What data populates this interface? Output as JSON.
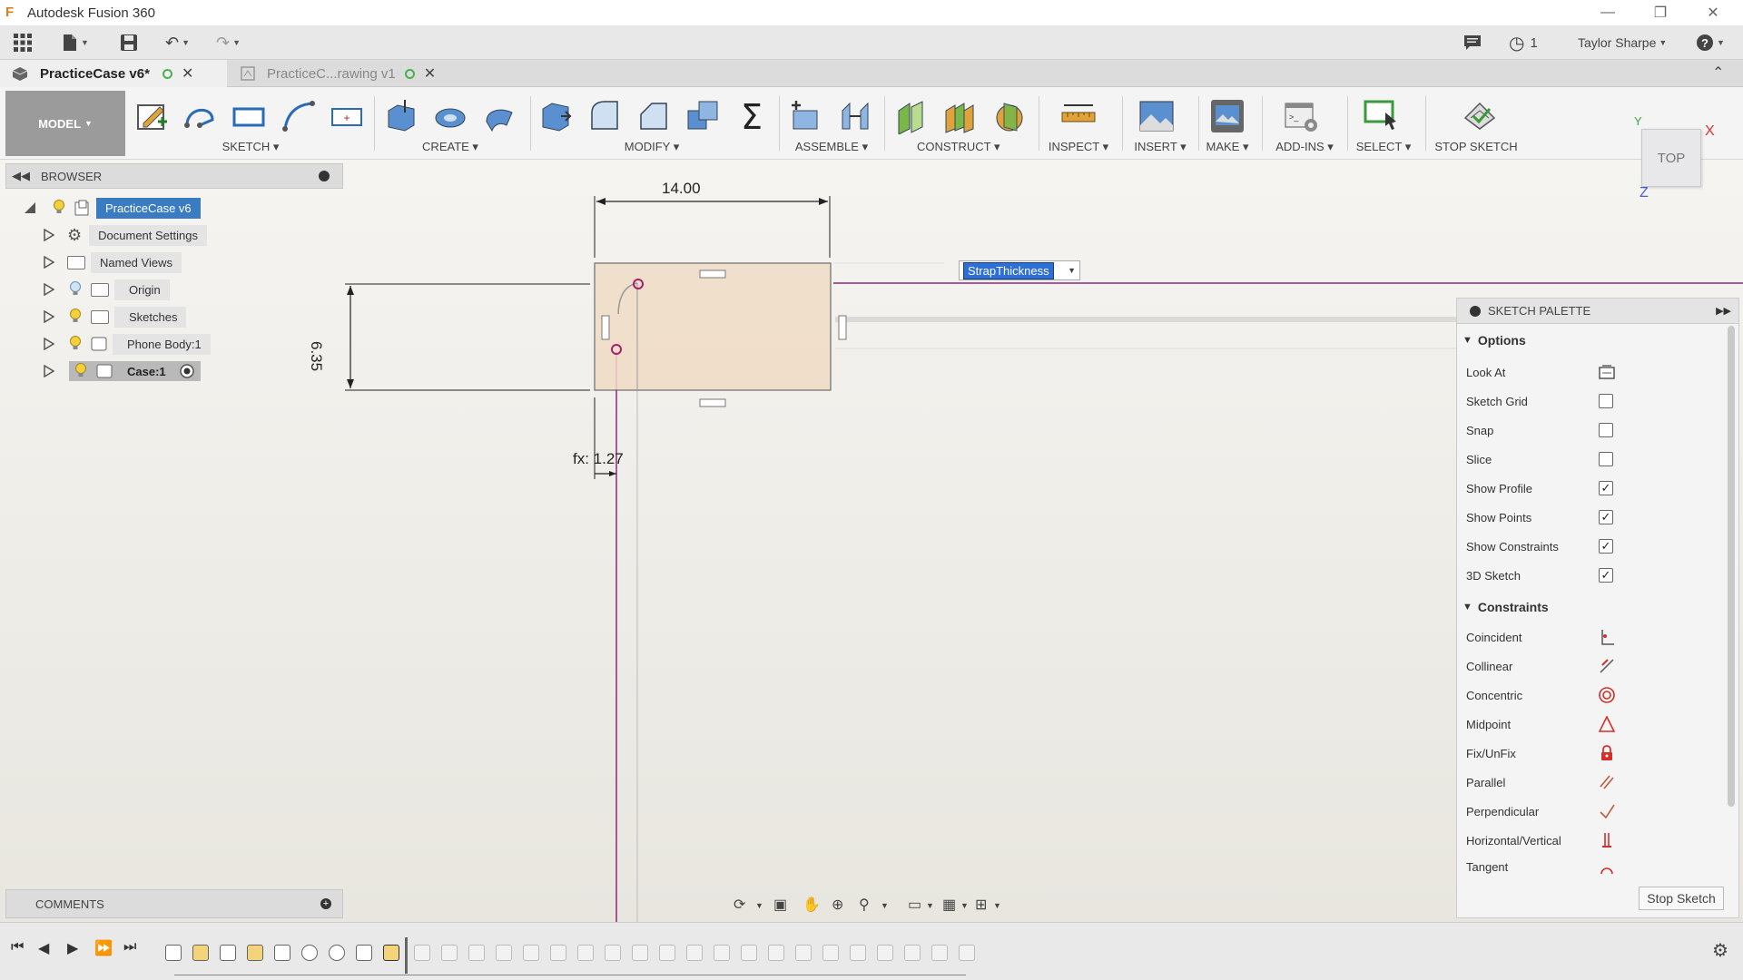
{
  "app": {
    "title": "Autodesk Fusion 360"
  },
  "quick_access": {
    "user_name": "Taylor Sharpe",
    "jobs_count": "1"
  },
  "tabs": [
    {
      "label": "PracticeCase v6*"
    },
    {
      "label": "PracticeC...rawing v1"
    }
  ],
  "toolbar": {
    "workspace": "MODEL",
    "groups": [
      {
        "label": "SKETCH"
      },
      {
        "label": "CREATE"
      },
      {
        "label": "MODIFY"
      },
      {
        "label": "ASSEMBLE"
      },
      {
        "label": "CONSTRUCT"
      },
      {
        "label": "INSPECT"
      },
      {
        "label": "INSERT"
      },
      {
        "label": "MAKE"
      },
      {
        "label": "ADD-INS"
      },
      {
        "label": "SELECT"
      },
      {
        "label": "STOP SKETCH"
      }
    ]
  },
  "browser": {
    "title": "BROWSER",
    "items": [
      {
        "label": "PracticeCase v6"
      },
      {
        "label": "Document Settings"
      },
      {
        "label": "Named Views"
      },
      {
        "label": "Origin"
      },
      {
        "label": "Sketches"
      },
      {
        "label": "Phone Body:1"
      },
      {
        "label": "Case:1"
      }
    ]
  },
  "sketch": {
    "width_dimension": "14.00",
    "height_dimension": "6.35",
    "offset_dimension": "fx: 1.27",
    "parameter_input": "StrapThickness"
  },
  "viewcube": {
    "face": "TOP",
    "axis_x": "X",
    "axis_y": "Y",
    "axis_z": "Z"
  },
  "palette": {
    "title": "SKETCH PALETTE",
    "options_header": "Options",
    "options": [
      {
        "label": "Look At",
        "checked": null
      },
      {
        "label": "Sketch Grid",
        "checked": false
      },
      {
        "label": "Snap",
        "checked": false
      },
      {
        "label": "Slice",
        "checked": false
      },
      {
        "label": "Show Profile",
        "checked": true
      },
      {
        "label": "Show Points",
        "checked": true
      },
      {
        "label": "Show Constraints",
        "checked": true
      },
      {
        "label": "3D Sketch",
        "checked": true
      }
    ],
    "constraints_header": "Constraints",
    "constraints": [
      {
        "label": "Coincident",
        "icon": "coincident-icon"
      },
      {
        "label": "Collinear",
        "icon": "collinear-icon"
      },
      {
        "label": "Concentric",
        "icon": "concentric-icon"
      },
      {
        "label": "Midpoint",
        "icon": "midpoint-icon"
      },
      {
        "label": "Fix/UnFix",
        "icon": "lock-icon"
      },
      {
        "label": "Parallel",
        "icon": "parallel-icon"
      },
      {
        "label": "Perpendicular",
        "icon": "perpendicular-icon"
      },
      {
        "label": "Horizontal/Vertical",
        "icon": "horizontal-vertical-icon"
      },
      {
        "label": "Tangent",
        "icon": "tangent-icon"
      }
    ],
    "stop_button": "Stop Sketch"
  },
  "comments": {
    "title": "COMMENTS"
  },
  "colors": {
    "accent_blue": "#3a7cc1",
    "sketch_line": "#8b2a7a",
    "profile_fill": "#f0dcc6",
    "constraint_red": "#d2302c"
  }
}
